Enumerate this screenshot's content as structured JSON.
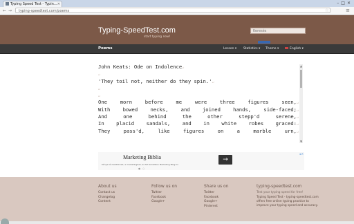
{
  "browser": {
    "tab_title": "Typing Speed Test - Typin...",
    "url": "typing-speedtest.com/poems",
    "search_placeholder": "Keresés"
  },
  "header": {
    "logo": "Typing-SpeedTest.com",
    "tagline": "start typing now!"
  },
  "navbar": {
    "section": "Poems",
    "lesson": "Lesson ▾",
    "statistics": "Statistics ▾",
    "theme": "Theme ▾",
    "language": "English ▾"
  },
  "poem": {
    "lines": [
      "John Keats: Ode on Indolence",
      "",
      "'They toil not, neither do they spin.'",
      "",
      "",
      "One morn before me were three figures seen,",
      "With bowed necks, and joined hands, side-faced;",
      "And one behind the other stepp'd serene,",
      "In placid sandals, and in white robes graced:",
      "They pass'd, like figures on a marble urn,"
    ]
  },
  "ad": {
    "title": "Marketing Biblia",
    "text": "Kényei és kezdőknek, a marketinghez, az SZ tematikus Marketing Blog.hu",
    "button": "→"
  },
  "footer": {
    "about": {
      "heading": "About us",
      "items": [
        "Contact us",
        "Changelog",
        "Content"
      ]
    },
    "follow": {
      "heading": "Follow us on",
      "items": [
        "Twitter",
        "Facebook",
        "Google+"
      ]
    },
    "share": {
      "heading": "Share us on",
      "items": [
        "Twitter",
        "Facebook",
        "Google+",
        "Pinterest"
      ]
    },
    "site": {
      "heading": "typing-speedtest.com",
      "subheading": "Test your typing speed for free!",
      "description": "Typing Speed Test - typing-speedtest.com offers free online typing practice to improve your typing speed and accuracy."
    }
  },
  "colors": {
    "header": "#7c5948",
    "navbar": "#3a3a3a",
    "footer": "#d9c8c0"
  }
}
